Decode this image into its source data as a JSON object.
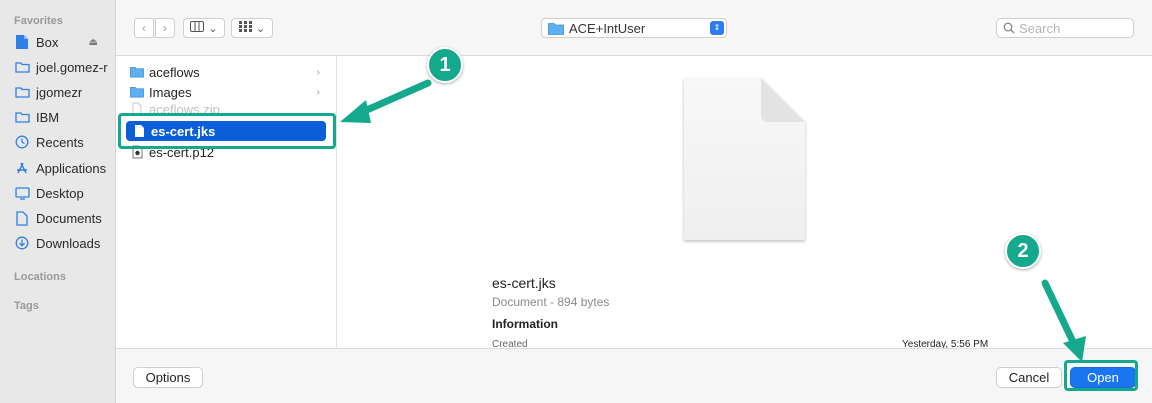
{
  "sidebar": {
    "favorites_title": "Favorites",
    "locations_title": "Locations",
    "tags_title": "Tags",
    "items": [
      {
        "label": "Box",
        "icon": "box-icon"
      },
      {
        "label": "joel.gomez-r",
        "icon": "folder-icon"
      },
      {
        "label": "jgomezr",
        "icon": "folder-icon"
      },
      {
        "label": "IBM",
        "icon": "folder-icon"
      },
      {
        "label": "Recents",
        "icon": "clock-icon"
      },
      {
        "label": "Applications",
        "icon": "applications-icon"
      },
      {
        "label": "Desktop",
        "icon": "desktop-icon"
      },
      {
        "label": "Documents",
        "icon": "document-icon"
      },
      {
        "label": "Downloads",
        "icon": "download-icon"
      }
    ]
  },
  "toolbar": {
    "back": "‹",
    "forward": "›",
    "current_folder": "ACE+IntUser",
    "search_placeholder": "Search"
  },
  "files": [
    {
      "name": "aceflows",
      "kind": "folder"
    },
    {
      "name": "Images",
      "kind": "folder"
    },
    {
      "name": "aceflows.zip",
      "kind": "zip"
    },
    {
      "name": "es-cert.jks",
      "kind": "document",
      "selected": true
    },
    {
      "name": "es-cert.p12",
      "kind": "certificate"
    }
  ],
  "preview": {
    "filename": "es-cert.jks",
    "kind": "Document - 894 bytes",
    "info_heading": "Information",
    "created_label": "Created",
    "created_value": "Yesterday, 5:56 PM"
  },
  "buttons": {
    "options": "Options",
    "cancel": "Cancel",
    "open": "Open"
  },
  "annotations": {
    "step1": "1",
    "step2": "2",
    "accent": "#14a98c"
  }
}
